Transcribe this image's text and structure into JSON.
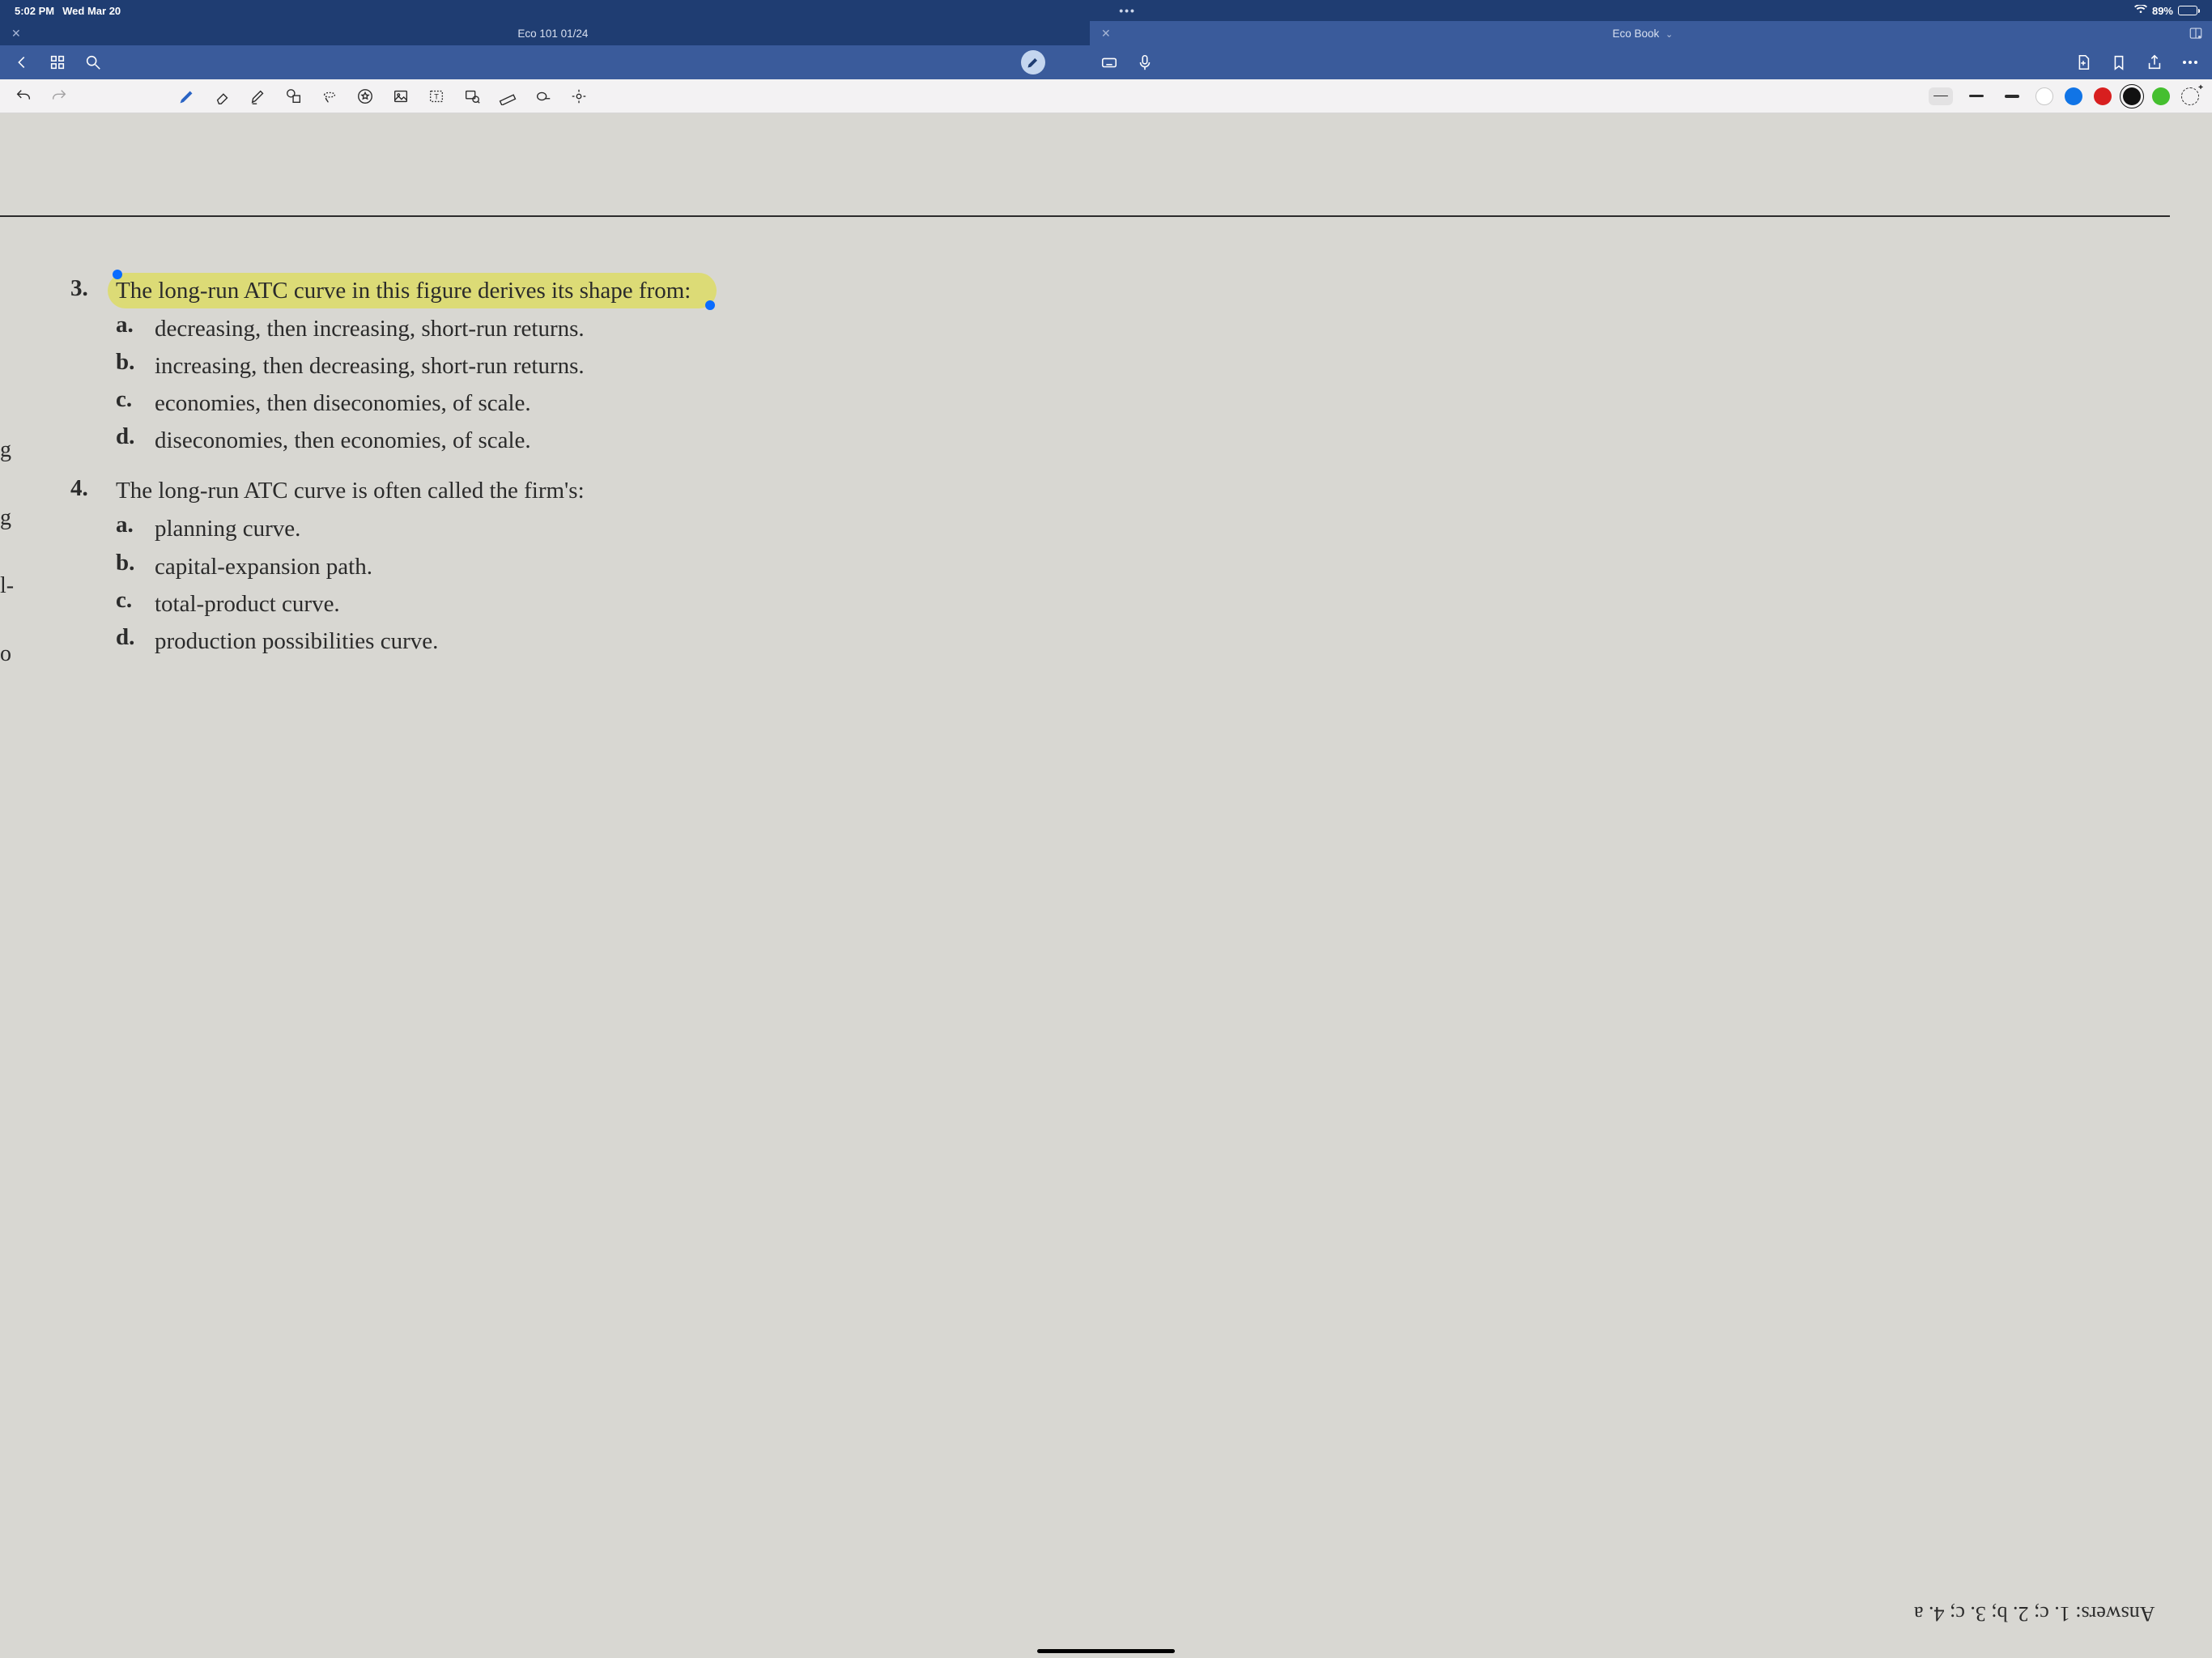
{
  "status": {
    "time": "5:02 PM",
    "date": "Wed Mar 20",
    "ellipsis": "•••",
    "battery_pct": "89%"
  },
  "tabs": [
    {
      "label": "Eco 101 01/24",
      "active": false
    },
    {
      "label": "Eco Book",
      "active": true,
      "dropdown": true
    }
  ],
  "questions": [
    {
      "num": "3.",
      "text": "The long-run ATC curve in this figure derives its shape from:",
      "highlighted": true,
      "options": [
        {
          "label": "a.",
          "text": "decreasing, then increasing, short-run returns."
        },
        {
          "label": "b.",
          "text": "increasing, then decreasing, short-run returns."
        },
        {
          "label": "c.",
          "text": "economies, then diseconomies, of scale."
        },
        {
          "label": "d.",
          "text": "diseconomies, then economies, of scale."
        }
      ]
    },
    {
      "num": "4.",
      "text": "The long-run ATC curve is often called the firm's:",
      "highlighted": false,
      "options": [
        {
          "label": "a.",
          "text": "planning curve."
        },
        {
          "label": "b.",
          "text": "capital-expansion path."
        },
        {
          "label": "c.",
          "text": "total-product curve."
        },
        {
          "label": "d.",
          "text": "production possibilities curve."
        }
      ]
    }
  ],
  "marginal_fragments": [
    "g",
    "g",
    "l-",
    "o"
  ],
  "answers_line": "Answers: 1. c; 2. b; 3. c; 4. a",
  "colors": {
    "highlight": "#dcdb76",
    "selection_handle": "#0a6cff",
    "header_dark": "#1f3d72",
    "header_mid": "#3a5b9b"
  }
}
